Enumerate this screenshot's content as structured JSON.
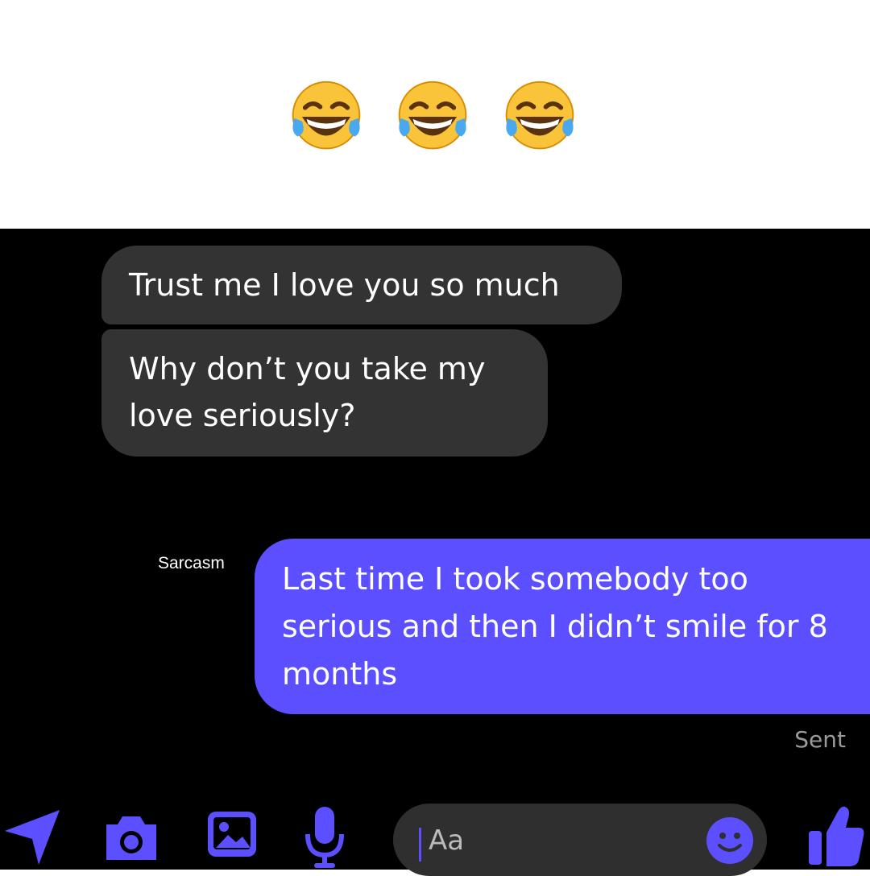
{
  "header": {
    "emojis": [
      "face-with-tears-of-joy",
      "face-with-tears-of-joy",
      "face-with-tears-of-joy"
    ]
  },
  "conversation": {
    "incoming": [
      "Trust me I love you so much",
      "Why don’t you take my love seriously?"
    ],
    "outgoing_caption": "Sarcasm",
    "outgoing": "Last time I took somebody too serious and then I didn’t smile for 8 months",
    "status": "Sent"
  },
  "composer": {
    "placeholder": "Aa",
    "icons": [
      "location-arrow-icon",
      "camera-icon",
      "gallery-icon",
      "microphone-icon",
      "emoji-icon",
      "thumbs-up-icon"
    ]
  },
  "colors": {
    "accent": "#5b4fff",
    "incoming_bubble": "#333333",
    "background": "#000000"
  }
}
